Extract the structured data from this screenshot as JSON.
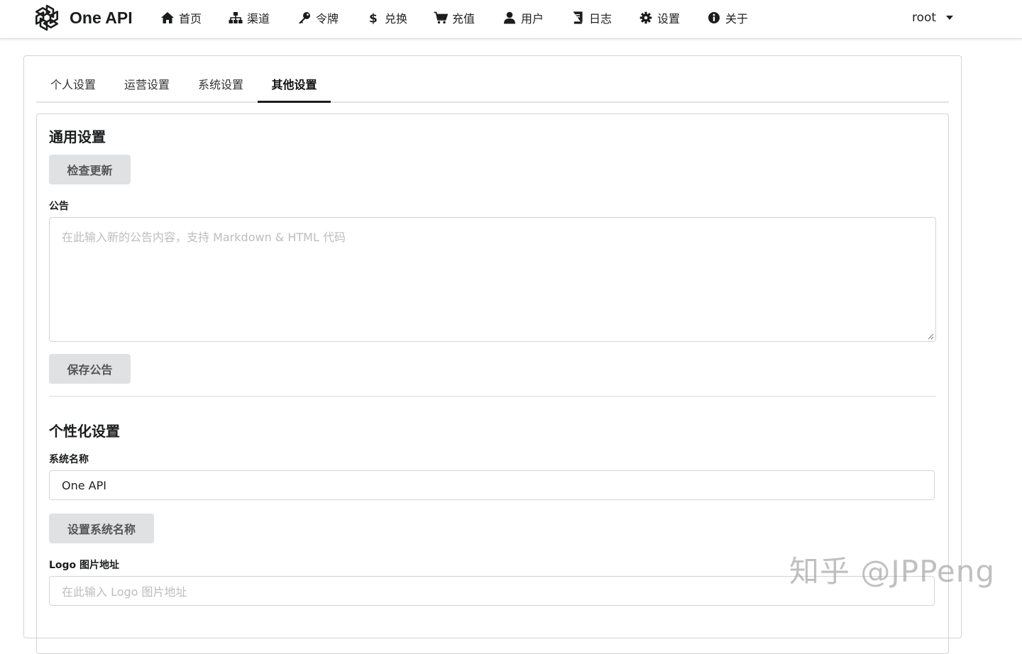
{
  "app": {
    "name": "One API"
  },
  "nav": {
    "items": [
      {
        "label": "首页",
        "icon": "home-icon"
      },
      {
        "label": "渠道",
        "icon": "sitemap-icon"
      },
      {
        "label": "令牌",
        "icon": "key-icon"
      },
      {
        "label": "兑换",
        "icon": "dollar-icon"
      },
      {
        "label": "充值",
        "icon": "cart-icon"
      },
      {
        "label": "用户",
        "icon": "user-icon"
      },
      {
        "label": "日志",
        "icon": "book-icon"
      },
      {
        "label": "设置",
        "icon": "gear-icon"
      },
      {
        "label": "关于",
        "icon": "info-icon"
      }
    ],
    "user": "root"
  },
  "tabs": [
    {
      "label": "个人设置",
      "active": false
    },
    {
      "label": "运营设置",
      "active": false
    },
    {
      "label": "系统设置",
      "active": false
    },
    {
      "label": "其他设置",
      "active": true
    }
  ],
  "general": {
    "title": "通用设置",
    "check_update_label": "检查更新",
    "notice_label": "公告",
    "notice_placeholder": "在此输入新的公告内容，支持 Markdown & HTML 代码",
    "notice_value": "",
    "save_notice_label": "保存公告"
  },
  "personalization": {
    "title": "个性化设置",
    "system_name_label": "系统名称",
    "system_name_value": "One API",
    "set_system_name_label": "设置系统名称",
    "logo_label": "Logo 图片地址",
    "logo_placeholder": "在此输入 Logo 图片地址",
    "logo_value": ""
  },
  "watermark": "知乎 @JPPeng",
  "colors": {
    "button_bg": "#e0e1e2",
    "button_text": "#555555",
    "border": "#d4d4d5",
    "active_tab_underline": "#1b1c1d"
  }
}
